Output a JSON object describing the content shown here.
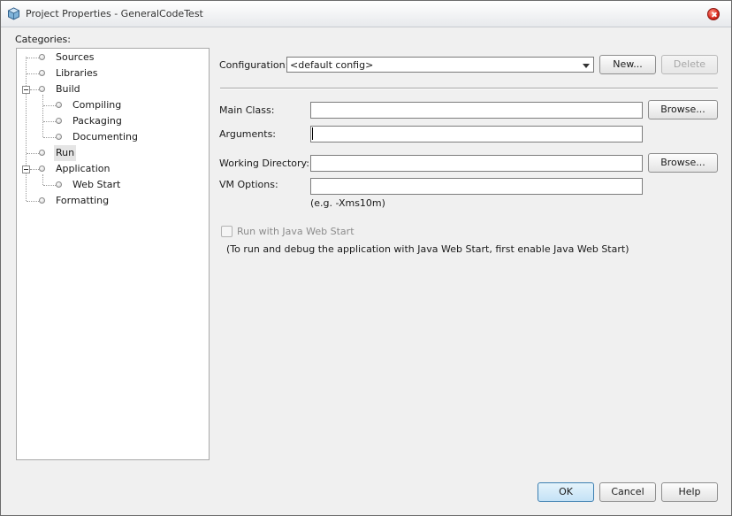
{
  "window": {
    "title": "Project Properties - GeneralCodeTest"
  },
  "categories": {
    "label": "Categories:",
    "items": [
      {
        "label": "Sources"
      },
      {
        "label": "Libraries"
      },
      {
        "label": "Build"
      },
      {
        "label": "Compiling"
      },
      {
        "label": "Packaging"
      },
      {
        "label": "Documenting"
      },
      {
        "label": "Run"
      },
      {
        "label": "Application"
      },
      {
        "label": "Web Start"
      },
      {
        "label": "Formatting"
      }
    ],
    "selected": "Run"
  },
  "configuration": {
    "label": "Configuration:",
    "value": "<default config>",
    "new_label": "New...",
    "delete_label": "Delete"
  },
  "run": {
    "main_class": {
      "label": "Main Class:",
      "value": "",
      "browse_label": "Browse..."
    },
    "arguments": {
      "label": "Arguments:",
      "value": ""
    },
    "working_directory": {
      "label": "Working Directory:",
      "value": "",
      "browse_label": "Browse..."
    },
    "vm_options": {
      "label": "VM Options:",
      "value": "",
      "hint": "(e.g. -Xms10m)"
    },
    "web_start": {
      "label": "Run with Java Web Start",
      "checked": false,
      "note": "(To run and debug the application with Java Web Start, first enable Java Web Start)"
    }
  },
  "footer": {
    "ok_label": "OK",
    "cancel_label": "Cancel",
    "help_label": "Help"
  },
  "icons": {
    "app": "netbeans-cube-icon",
    "close": "close-icon",
    "dropdown": "chevron-down-icon"
  }
}
